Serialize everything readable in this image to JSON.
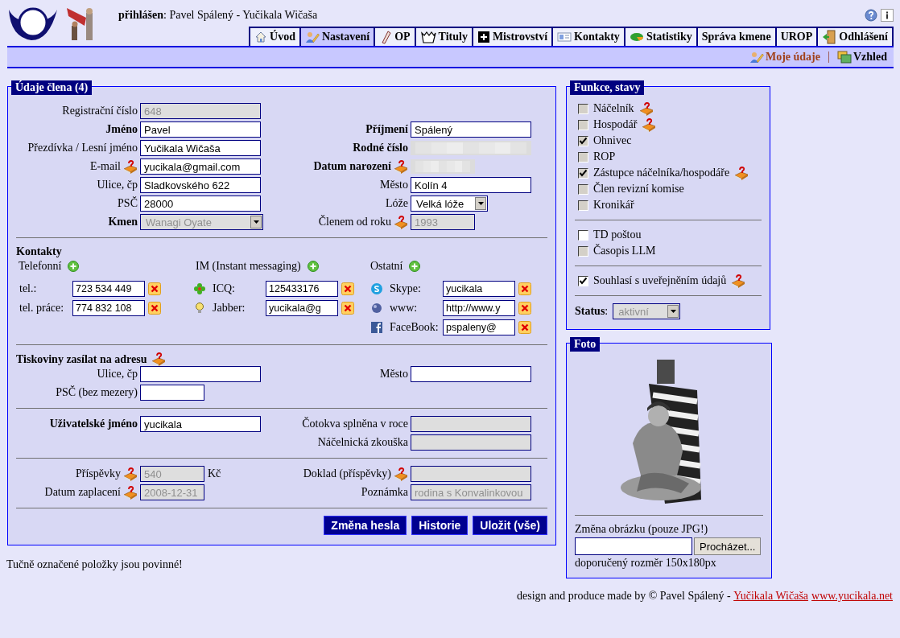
{
  "header": {
    "login": "**přihlášen**: Pavel Spálený - Yučikala Wičaša"
  },
  "tabs": [
    {
      "label": "Úvod",
      "selected": false
    },
    {
      "label": "Nastavení",
      "selected": true
    },
    {
      "label": "OP",
      "selected": false
    },
    {
      "label": "Tituly",
      "selected": false
    },
    {
      "label": "Mistrovství",
      "selected": false
    },
    {
      "label": "Kontakty",
      "selected": false
    },
    {
      "label": "Statistiky",
      "selected": false
    },
    {
      "label": "Správa kmene",
      "selected": false
    },
    {
      "label": "UROP",
      "selected": false
    },
    {
      "label": "Odhlášení",
      "selected": false
    }
  ],
  "subnav": [
    {
      "label": "Moje údaje",
      "selected": true
    },
    {
      "label": "Vzhled",
      "selected": false
    }
  ],
  "member": {
    "title": "Údaje člena (4)",
    "basic": [
      {
        "left": {
          "label": "Registrační číslo",
          "required": false,
          "help": false,
          "kind": "text",
          "disabled": true,
          "value": "648"
        }
      },
      {
        "left": {
          "label": "Jméno",
          "required": true,
          "help": false,
          "kind": "text",
          "disabled": false,
          "value": "Pavel"
        },
        "right": {
          "label": "Příjmení",
          "required": true,
          "help": false,
          "kind": "text",
          "disabled": false,
          "value": "Spálený"
        }
      },
      {
        "left": {
          "label": "Přezdívka / Lesní jméno",
          "required": false,
          "help": false,
          "kind": "text",
          "disabled": false,
          "value": "Yučikala Wičaša"
        },
        "right": {
          "label": "Rodné číslo",
          "required": true,
          "help": false,
          "kind": "blurred",
          "disabled": true
        }
      },
      {
        "left": {
          "label": "E-mail",
          "required": false,
          "help": true,
          "kind": "text",
          "disabled": false,
          "value": "yucikala@gmail.com"
        },
        "right": {
          "label": "Datum narození",
          "required": true,
          "help": true,
          "kind": "blurred",
          "disabled": true
        }
      },
      {
        "left": {
          "label": "Ulice, čp",
          "required": false,
          "help": false,
          "kind": "text",
          "disabled": false,
          "value": "Sladkovského 622"
        },
        "right": {
          "label": "Město",
          "required": false,
          "help": false,
          "kind": "text",
          "disabled": false,
          "value": "Kolín 4"
        }
      },
      {
        "left": {
          "label": "PSČ",
          "required": false,
          "help": false,
          "kind": "text",
          "disabled": false,
          "value": "28000"
        },
        "right": {
          "label": "Lóže",
          "required": false,
          "help": false,
          "kind": "select",
          "disabled": false,
          "value": "Velká lóže"
        }
      },
      {
        "left": {
          "label": "Kmen",
          "required": true,
          "help": false,
          "kind": "select",
          "disabled": true,
          "value": "Wanagi Oyate"
        },
        "right": {
          "label": "Členem od roku",
          "required": false,
          "help": true,
          "kind": "text",
          "disabled": true,
          "value": "1993"
        }
      }
    ],
    "contacts": {
      "title": "Kontakty",
      "groups": [
        {
          "title": "Telefonní",
          "items": [
            {
              "label": "tel.:",
              "value": "723 534 449"
            },
            {
              "label": "tel. práce:",
              "value": "774 832 108"
            }
          ]
        },
        {
          "title": "IM (Instant messaging)",
          "items": [
            {
              "label": "ICQ:",
              "value": "125433176"
            },
            {
              "label": "Jabber:",
              "value": "yucikala@g"
            }
          ]
        },
        {
          "title": "Ostatní",
          "items": [
            {
              "label": "Skype:",
              "value": "yucikala"
            },
            {
              "label": "www:",
              "value": "http://www.y"
            },
            {
              "label": "FaceBook:",
              "value": "pspaleny@"
            }
          ]
        }
      ]
    },
    "mailing": {
      "title": "Tiskoviny zasílat na adresu",
      "help": true,
      "rows": [
        {
          "left": {
            "label": "Ulice, čp",
            "required": false,
            "help": false,
            "kind": "text",
            "disabled": false
          },
          "right": {
            "label": "Město",
            "required": false,
            "help": false,
            "kind": "text",
            "disabled": false
          }
        },
        {
          "left": {
            "label": "PSČ (bez mezery)",
            "required": false,
            "help": false,
            "kind": "text",
            "disabled": false
          }
        }
      ]
    },
    "account": [
      {
        "left": {
          "label": "Uživatelské jméno",
          "required": true,
          "help": false,
          "kind": "text",
          "disabled": false,
          "value": "yucikala"
        },
        "right": {
          "label": "Čotokva splněna v roce",
          "required": false,
          "help": false,
          "kind": "text",
          "disabled": true
        }
      },
      {
        "right": {
          "label": "Náčelnická zkouška",
          "required": false,
          "help": false,
          "kind": "text",
          "disabled": true
        }
      }
    ],
    "payments": [
      {
        "left": {
          "label": "Příspěvky",
          "required": false,
          "help": true,
          "kind": "text",
          "disabled": true,
          "value": "540",
          "suffix": "Kč"
        },
        "right": {
          "label": "Doklad (příspěvky)",
          "required": false,
          "help": true,
          "kind": "text",
          "disabled": true
        }
      },
      {
        "left": {
          "label": "Datum zaplacení",
          "required": false,
          "help": true,
          "kind": "text",
          "disabled": true,
          "value": "2008-12-31"
        },
        "right": {
          "label": "Poznámka",
          "required": false,
          "help": false,
          "kind": "text",
          "disabled": true,
          "value": "rodina s Konvalinkovou"
        }
      }
    ],
    "buttons": [
      "Změna hesla",
      "Historie",
      "Uložit (vše)"
    ]
  },
  "note": "Tučně označené položky jsou povinné!",
  "functions": {
    "title": "Funkce, stavy",
    "groups": [
      [
        {
          "label": "Náčelník",
          "checked": false,
          "disabled": true,
          "help": true
        },
        {
          "label": "Hospodář",
          "checked": false,
          "disabled": true,
          "help": true
        },
        {
          "label": "Ohnivec",
          "checked": true,
          "disabled": true,
          "help": false
        },
        {
          "label": "ROP",
          "checked": false,
          "disabled": true,
          "help": false
        },
        {
          "label": "Zástupce náčelníka/hospodáře",
          "checked": true,
          "disabled": true,
          "help": true
        },
        {
          "label": "Člen revizní komise",
          "checked": false,
          "disabled": true,
          "help": false
        },
        {
          "label": "Kronikář",
          "checked": false,
          "disabled": true,
          "help": false
        }
      ],
      [
        {
          "label": "TD poštou",
          "checked": false,
          "disabled": false,
          "help": false
        },
        {
          "label": "Časopis LLM",
          "checked": false,
          "disabled": true,
          "help": false
        }
      ],
      [
        {
          "label": "Souhlasí s uveřejněním údajů",
          "checked": true,
          "disabled": false,
          "help": true
        }
      ]
    ],
    "status_label": "**Status**:",
    "status": {
      "value": "aktivní",
      "disabled": true
    }
  },
  "photo": {
    "title": "Foto",
    "change_label": "Změna obrázku (pouze JPG!)",
    "browse": "Procházet...",
    "hint": "doporučený rozměr 150x180px"
  },
  "footer": {
    "text": "design and produce made by © Pavel Spálený - ",
    "links": [
      "Yučikala Wičaša",
      "www.yucikala.net"
    ]
  }
}
